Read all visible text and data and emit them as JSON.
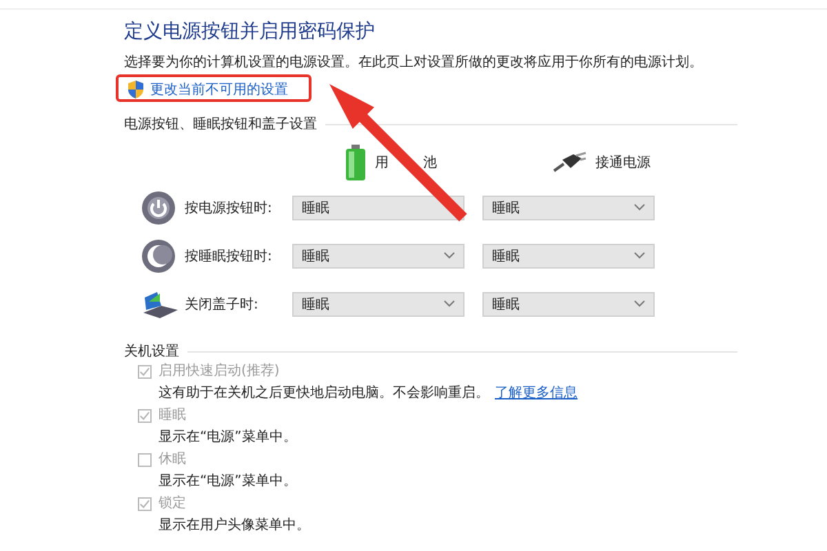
{
  "title": "定义电源按钮并启用密码保护",
  "description": "选择要为你的计算机设置的电源设置。在此页上对设置所做的更改将应用于你所有的电源计划。",
  "admin_link": "更改当前不可用的设置",
  "buttons_section": {
    "heading": "电源按钮、睡眠按钮和盖子设置",
    "columns": [
      {
        "kind": "battery",
        "label": "用 池"
      },
      {
        "kind": "plugged",
        "label": "接通电源"
      }
    ],
    "rows": [
      {
        "kind": "power",
        "label": "按电源按钮时:",
        "values": [
          "睡眠",
          "睡眠"
        ]
      },
      {
        "kind": "sleep",
        "label": "按睡眠按钮时:",
        "values": [
          "睡眠",
          "睡眠"
        ]
      },
      {
        "kind": "lid",
        "label": "关闭盖子时:",
        "values": [
          "睡眠",
          "睡眠"
        ]
      }
    ]
  },
  "shutdown_section": {
    "heading": "关机设置",
    "options": [
      {
        "label": "启用快速启动(推荐)",
        "checked": true,
        "disabled": true,
        "note": "这有助于在关机之后更快地启动电脑。不会影响重启。",
        "link": "了解更多信息"
      },
      {
        "label": "睡眠",
        "checked": true,
        "disabled": true,
        "note": "显示在“电源”菜单中。"
      },
      {
        "label": "休眠",
        "checked": false,
        "disabled": true,
        "note": "显示在“电源”菜单中。"
      },
      {
        "label": "锁定",
        "checked": true,
        "disabled": true,
        "note": "显示在用户头像菜单中。"
      }
    ]
  }
}
